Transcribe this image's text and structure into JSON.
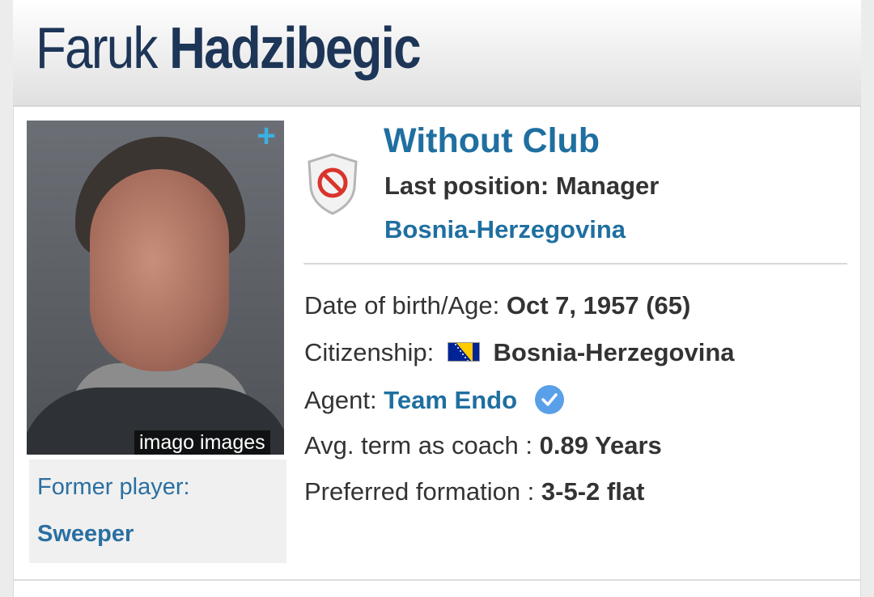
{
  "profile": {
    "first_name": "Faruk",
    "last_name": "Hadzibegic",
    "photo_credit": "imago images",
    "photo_plus": "+",
    "former_player_label": "Former player:",
    "former_position": "Sweeper"
  },
  "club": {
    "status": "Without Club",
    "last_position": "Last position: Manager",
    "country": "Bosnia-Herzegovina",
    "badge_icon": "no-club-shield-icon"
  },
  "details": {
    "dob_label": "Date of birth/Age:",
    "dob_value": "Oct 7, 1957 (65)",
    "citizenship_label": "Citizenship:",
    "citizenship_value": "Bosnia-Herzegovina",
    "agent_label": "Agent:",
    "agent_value": "Team Endo",
    "term_label": "Avg. term as coach :",
    "term_value": "0.89 Years",
    "formation_label": "Preferred formation :",
    "formation_value": "3-5-2 flat"
  },
  "colors": {
    "title": "#1d3557",
    "link": "#1f6fa0",
    "verified": "#5aa0e8"
  }
}
